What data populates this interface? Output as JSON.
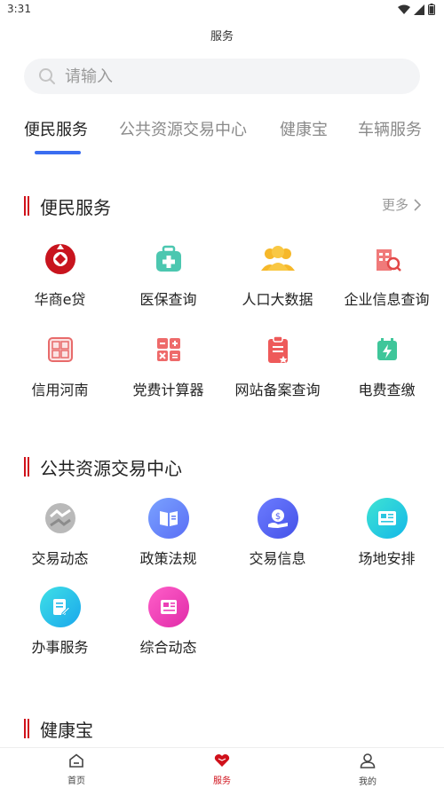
{
  "status": {
    "time": "3:31"
  },
  "header": {
    "title": "服务"
  },
  "search": {
    "placeholder": "请输入"
  },
  "tabs": [
    {
      "label": "便民服务",
      "active": true
    },
    {
      "label": "公共资源交易中心"
    },
    {
      "label": "健康宝"
    },
    {
      "label": "车辆服务"
    }
  ],
  "sections": {
    "bianmin": {
      "title": "便民服务",
      "more": "更多",
      "items": [
        {
          "label": "华商e贷",
          "icon": "huashang-loan-icon"
        },
        {
          "label": "医保查询",
          "icon": "medical-kit-icon"
        },
        {
          "label": "人口大数据",
          "icon": "people-group-icon"
        },
        {
          "label": "企业信息查询",
          "icon": "building-search-icon"
        },
        {
          "label": "信用河南",
          "icon": "seal-stamp-icon"
        },
        {
          "label": "党费计算器",
          "icon": "calculator-icon"
        },
        {
          "label": "网站备案查询",
          "icon": "clipboard-star-icon"
        },
        {
          "label": "电费查缴",
          "icon": "battery-bolt-icon"
        }
      ]
    },
    "gonggong": {
      "title": "公共资源交易中心",
      "items": [
        {
          "label": "交易动态",
          "icon": "exchange-icon"
        },
        {
          "label": "政策法规",
          "icon": "policy-book-icon"
        },
        {
          "label": "交易信息",
          "icon": "money-hand-icon"
        },
        {
          "label": "场地安排",
          "icon": "news-card-icon"
        },
        {
          "label": "办事服务",
          "icon": "document-edit-icon"
        },
        {
          "label": "综合动态",
          "icon": "newspaper-icon"
        }
      ]
    },
    "jiankang": {
      "title": "健康宝"
    }
  },
  "bottom_nav": [
    {
      "label": "首页",
      "icon": "home-icon"
    },
    {
      "label": "服务",
      "icon": "heart-icon",
      "active": true
    },
    {
      "label": "我的",
      "icon": "user-icon"
    }
  ],
  "colors": {
    "accent_red": "#d0111b",
    "tab_indicator": "#3a6df0"
  }
}
